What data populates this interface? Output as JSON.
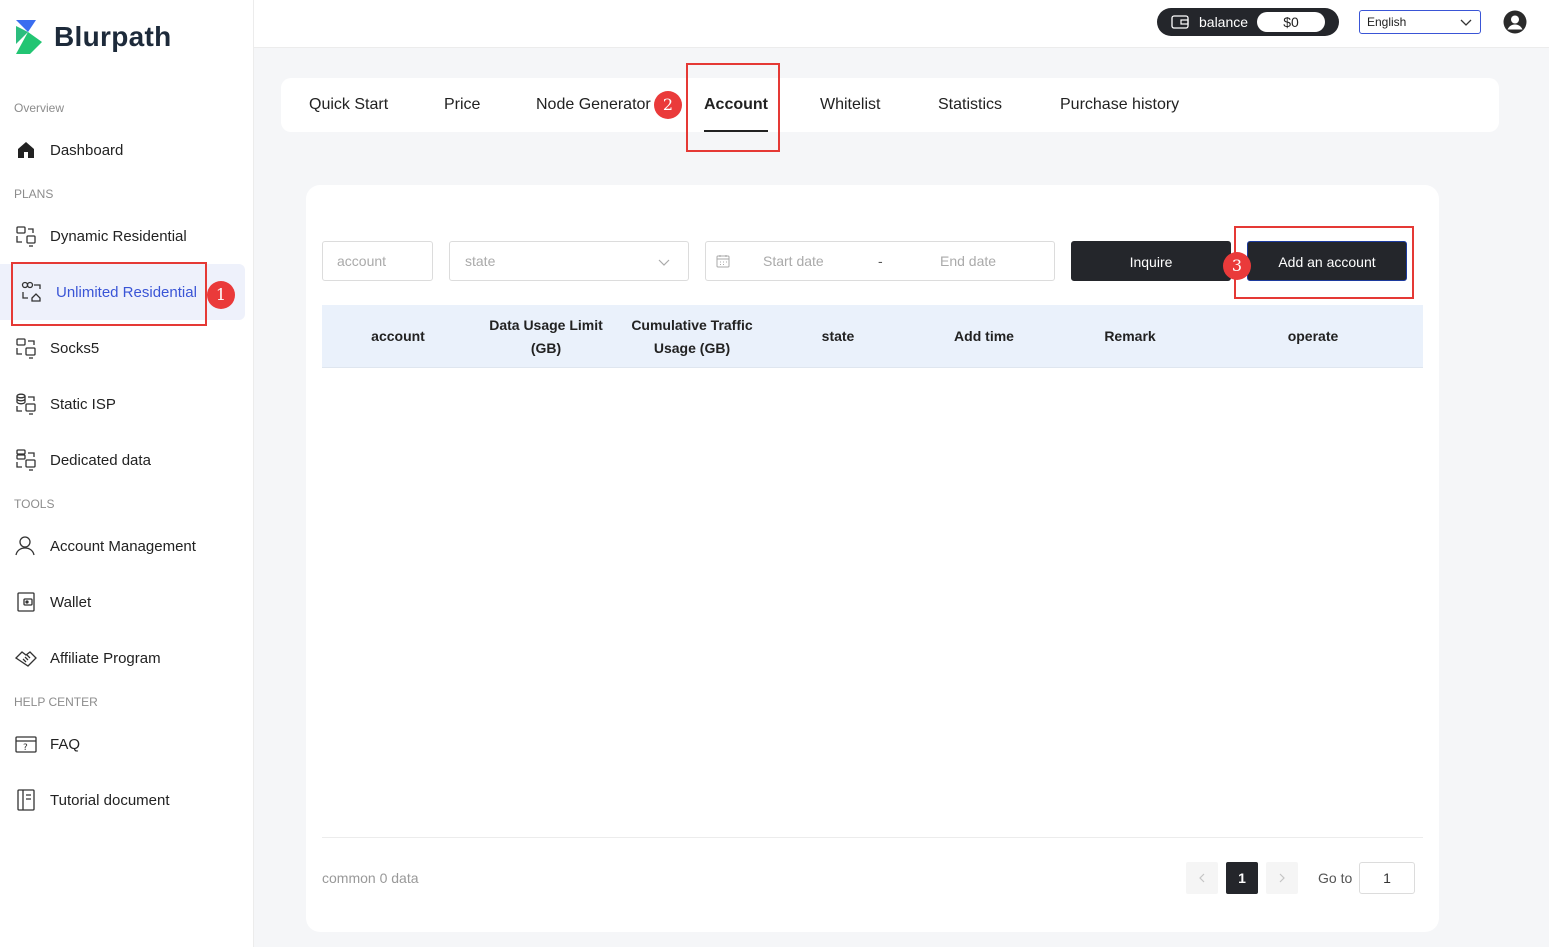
{
  "brand": {
    "name": "Blurpath"
  },
  "sidebar": {
    "sections": {
      "overview": "Overview",
      "plans": "PLANS",
      "tools": "TOOLS",
      "help": "HELP CENTER"
    },
    "items": [
      {
        "label": "Dashboard",
        "icon": "home-icon"
      },
      {
        "label": "Dynamic Residential",
        "icon": "dynamic-residential-icon"
      },
      {
        "label": "Unlimited Residential",
        "icon": "unlimited-residential-icon",
        "active": true
      },
      {
        "label": "Socks5",
        "icon": "socks5-icon"
      },
      {
        "label": "Static ISP",
        "icon": "static-isp-icon"
      },
      {
        "label": "Dedicated data",
        "icon": "dedicated-data-icon"
      },
      {
        "label": "Account Management",
        "icon": "user-icon"
      },
      {
        "label": "Wallet",
        "icon": "wallet-icon"
      },
      {
        "label": "Affiliate Program",
        "icon": "handshake-icon"
      },
      {
        "label": "FAQ",
        "icon": "faq-icon"
      },
      {
        "label": "Tutorial document",
        "icon": "document-icon"
      }
    ]
  },
  "header": {
    "balance_label": "balance",
    "balance_value": "$0",
    "language": "English"
  },
  "tabs": [
    {
      "label": "Quick Start"
    },
    {
      "label": "Price"
    },
    {
      "label": "Node Generator"
    },
    {
      "label": "Account",
      "active": true
    },
    {
      "label": "Whitelist"
    },
    {
      "label": "Statistics"
    },
    {
      "label": "Purchase history"
    }
  ],
  "filters": {
    "account_placeholder": "account",
    "state_placeholder": "state",
    "start_date": "Start date",
    "date_separator": "-",
    "end_date": "End date",
    "inquire": "Inquire",
    "add_account": "Add an account"
  },
  "table": {
    "columns": [
      "account",
      "Data Usage Limit (GB)",
      "Cumulative Traffic Usage (GB)",
      "state",
      "Add time",
      "Remark",
      "operate"
    ],
    "rows": []
  },
  "pagination": {
    "total_text": "common 0 data",
    "current_page": "1",
    "goto_label": "Go to",
    "goto_value": "1"
  },
  "annotations": [
    "1",
    "2",
    "3"
  ],
  "colors": {
    "accent": "#3a55d6",
    "dark": "#24262b",
    "annotation": "#e53935"
  }
}
